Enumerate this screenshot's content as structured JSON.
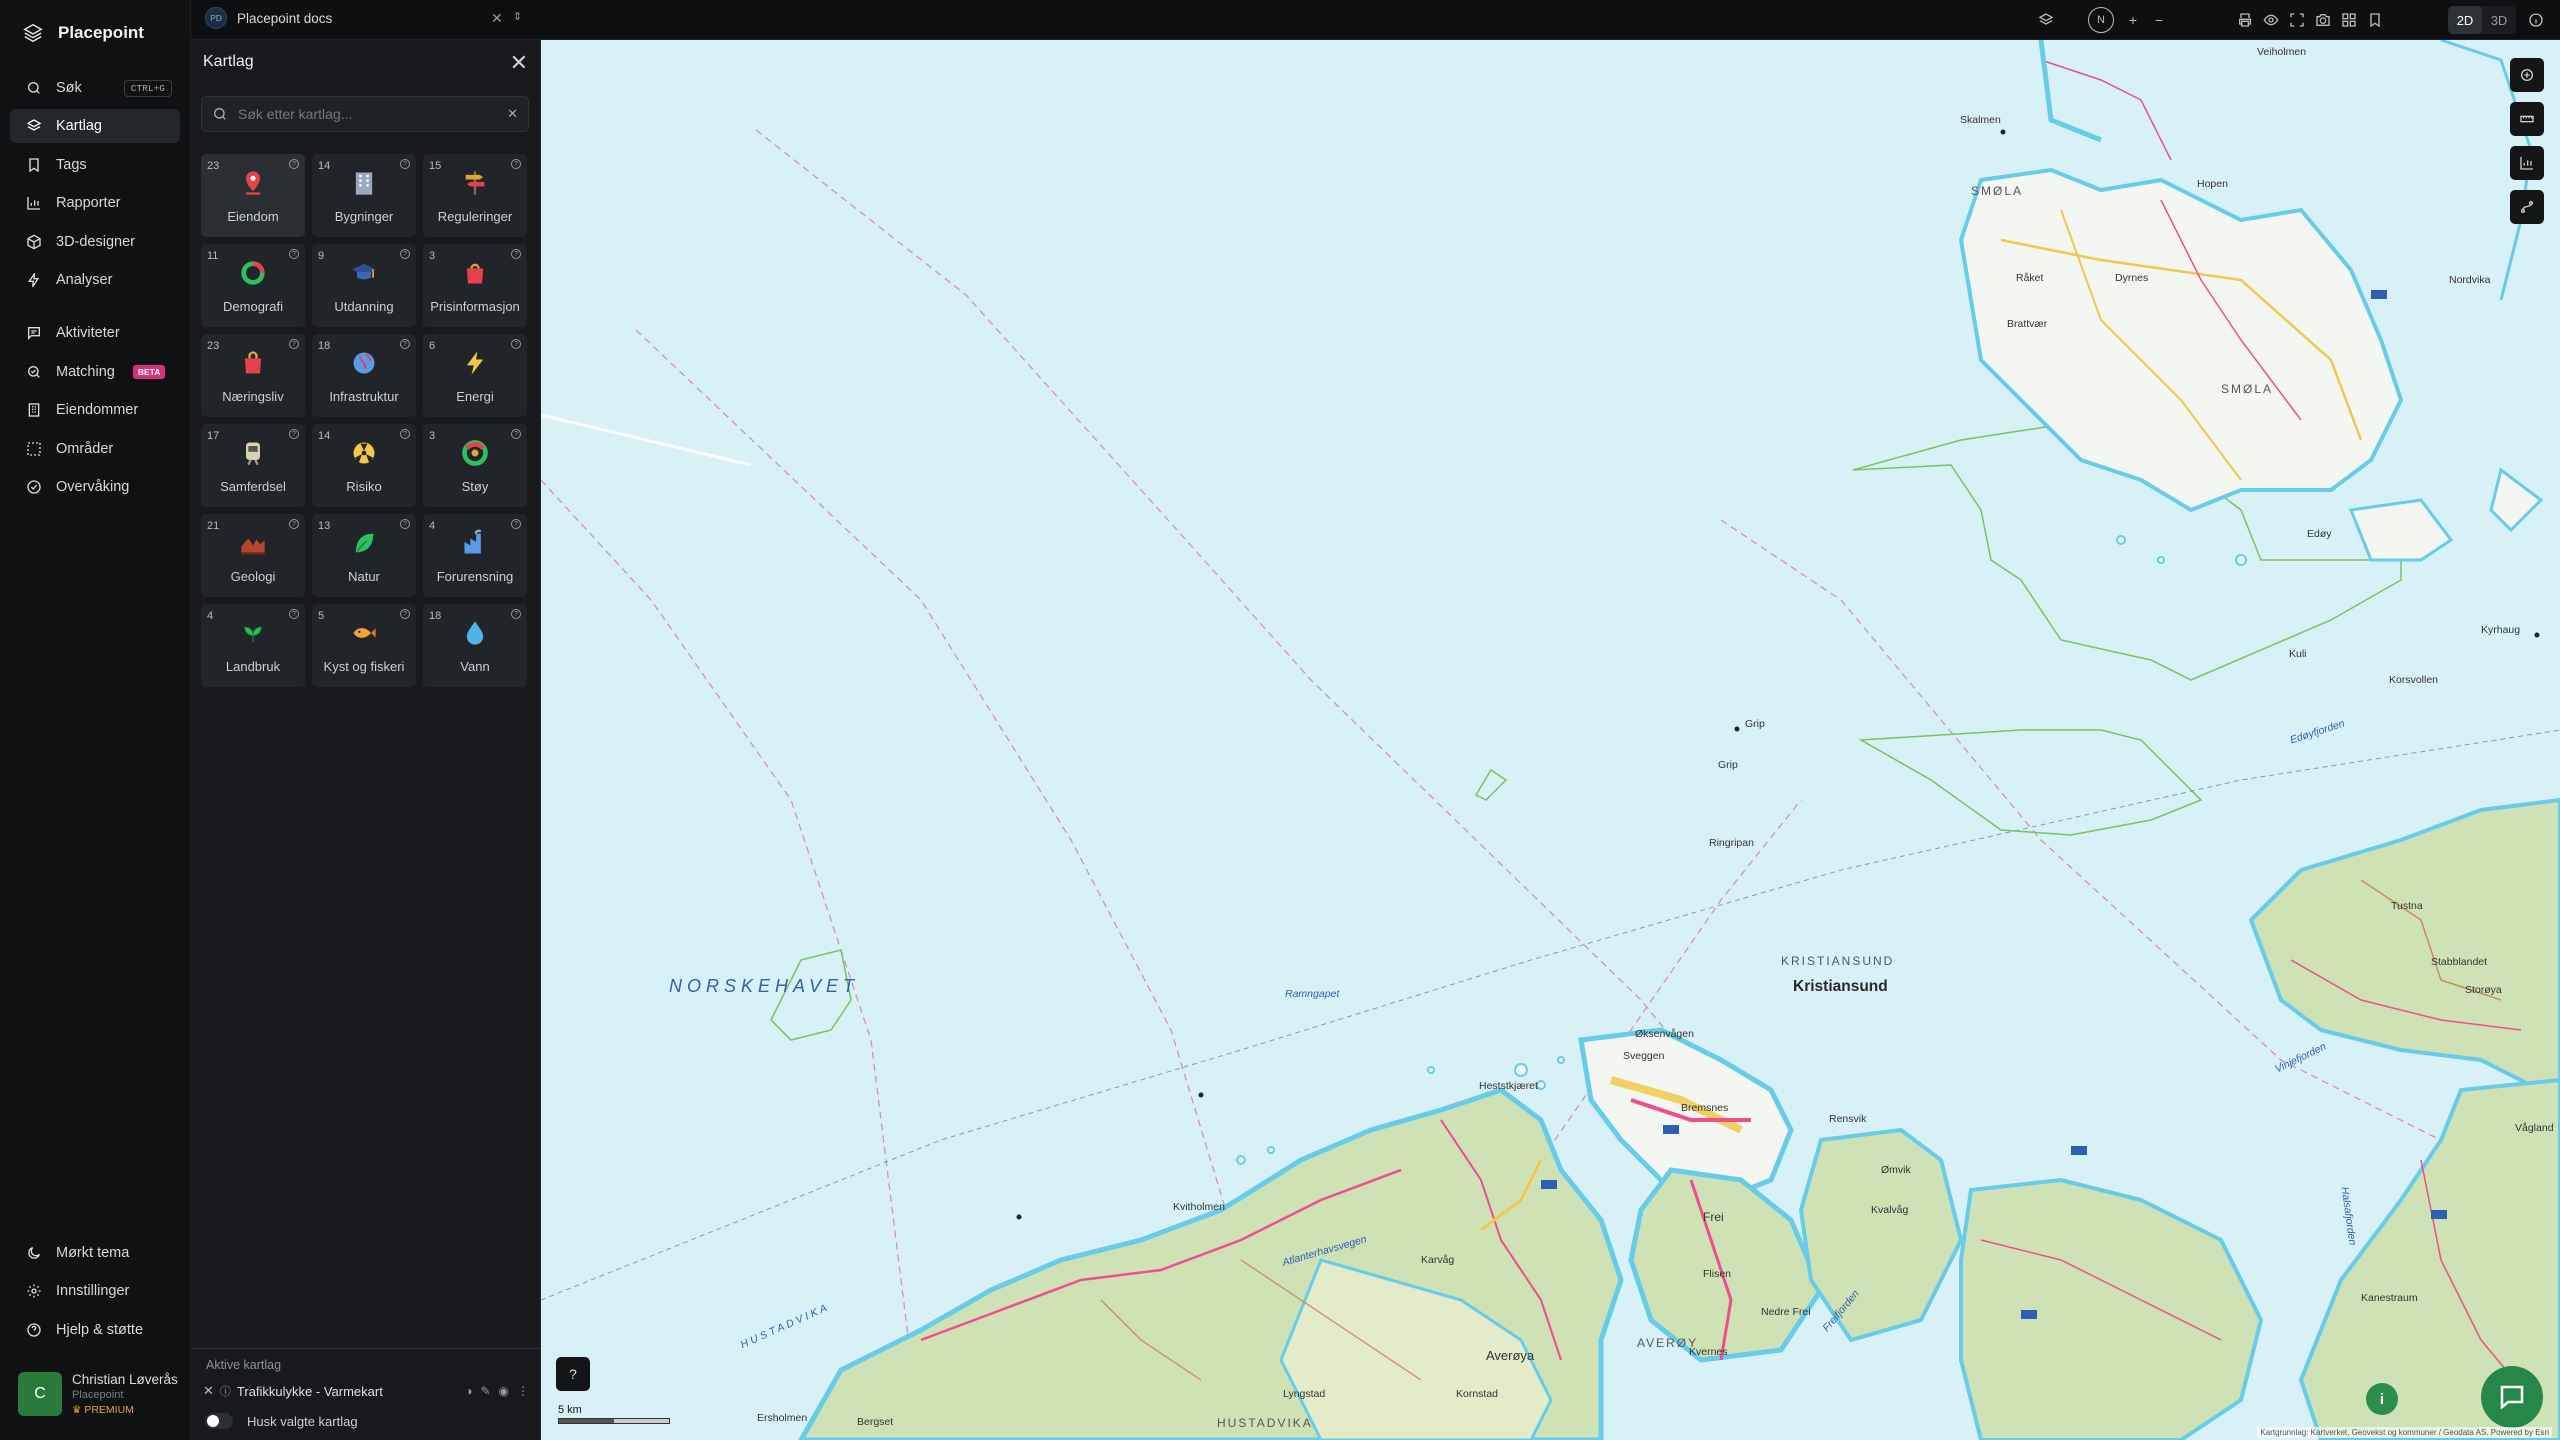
{
  "app": {
    "name": "Placepoint"
  },
  "nav": {
    "items": [
      {
        "label": "Søk",
        "icon": "search-icon",
        "shortcut": "CTRL+G"
      },
      {
        "label": "Kartlag",
        "icon": "layers-icon",
        "active": true
      },
      {
        "label": "Tags",
        "icon": "bookmark-icon"
      },
      {
        "label": "Rapporter",
        "icon": "bar-chart-icon"
      },
      {
        "label": "3D-designer",
        "icon": "cube-icon"
      },
      {
        "label": "Analyser",
        "icon": "bolt-icon"
      },
      {
        "label": "Aktiviteter",
        "icon": "chat-icon"
      },
      {
        "label": "Matching",
        "icon": "match-icon",
        "badge": "BETA"
      },
      {
        "label": "Eiendommer",
        "icon": "building-icon"
      },
      {
        "label": "Områder",
        "icon": "area-icon"
      },
      {
        "label": "Overvåking",
        "icon": "monitor-icon"
      }
    ],
    "bottom": [
      {
        "label": "Mørkt tema",
        "icon": "moon-icon"
      },
      {
        "label": "Innstillinger",
        "icon": "gear-icon"
      },
      {
        "label": "Hjelp & støtte",
        "icon": "help-icon"
      }
    ],
    "user": {
      "initial": "C",
      "name": "Christian Løverås",
      "org": "Placepoint",
      "plan": "PREMIUM"
    }
  },
  "topbar": {
    "doc_badge": "PD",
    "doc_title": "Placepoint docs",
    "compass": "N",
    "view_2d": "2D",
    "view_3d": "3D"
  },
  "panel": {
    "title": "Kartlag",
    "search_placeholder": "Søk etter kartlag...",
    "categories": [
      {
        "label": "Eiendom",
        "count": "23",
        "icon": "pin-icon",
        "selected": true
      },
      {
        "label": "Bygninger",
        "count": "14",
        "icon": "office-icon"
      },
      {
        "label": "Reguleringer",
        "count": "15",
        "icon": "signpost-icon"
      },
      {
        "label": "Demografi",
        "count": "11",
        "icon": "donut-icon"
      },
      {
        "label": "Utdanning",
        "count": "9",
        "icon": "graduation-icon"
      },
      {
        "label": "Prisinformasjon",
        "count": "3",
        "icon": "price-bag-icon"
      },
      {
        "label": "Næringsliv",
        "count": "23",
        "icon": "shopping-bag-icon"
      },
      {
        "label": "Infrastruktur",
        "count": "18",
        "icon": "globe-icon"
      },
      {
        "label": "Energi",
        "count": "6",
        "icon": "lightning-icon"
      },
      {
        "label": "Samferdsel",
        "count": "17",
        "icon": "train-icon"
      },
      {
        "label": "Risiko",
        "count": "14",
        "icon": "radiation-icon"
      },
      {
        "label": "Støy",
        "count": "3",
        "icon": "noise-gauge-icon"
      },
      {
        "label": "Geologi",
        "count": "21",
        "icon": "terrain-icon"
      },
      {
        "label": "Natur",
        "count": "13",
        "icon": "leaf-icon"
      },
      {
        "label": "Forurensning",
        "count": "4",
        "icon": "factory-icon"
      },
      {
        "label": "Landbruk",
        "count": "4",
        "icon": "sprout-icon"
      },
      {
        "label": "Kyst og fiskeri",
        "count": "5",
        "icon": "fish-icon"
      },
      {
        "label": "Vann",
        "count": "18",
        "icon": "water-drop-icon"
      }
    ],
    "active_title": "Aktive kartlag",
    "active_layers": [
      {
        "label": "Trafikkulykke - Varmekart"
      }
    ],
    "remember_label": "Husk valgte kartlag"
  },
  "map": {
    "labels": {
      "sea": "NORSKEHAVET",
      "kristiansund_caps": "KRISTIANSUND",
      "kristiansund": "Kristiansund",
      "smola_caps": "SMØLA",
      "smola": "SMØLA",
      "hustadvika_sea": "HUSTADVIKA",
      "hustadvika": "HUSTADVIKA",
      "averoy": "AVERØY",
      "averoy2": "Averøya",
      "ramngapet": "Ramngapet",
      "grip": "Grip",
      "grip2": "Grip",
      "ringripan": "Ringripan",
      "skalmen": "Skalmen",
      "kvitholmen": "Kvitholmen",
      "heststkjaeret": "Heststkjæret",
      "edoyfjorden": "Edøyfjorden",
      "frei": "Frei",
      "rensvik": "Rensvik",
      "tustna": "Tustna",
      "edoy": "Edøy",
      "kuli": "Kuli",
      "veiholmen": "Veiholmen",
      "hopen": "Hopen",
      "nordvika": "Nordvika",
      "dyrnes": "Dyrnes",
      "raket": "Råket",
      "brattvaer": "Brattvær",
      "kornstad": "Kornstad",
      "karvag": "Karvåg",
      "bremsnes": "Bremsnes",
      "atlanterhavsvegen": "Atlanterhavsvegen",
      "freifjorden": "Freifjorden",
      "vinjefjorden": "Vinjefjorden",
      "halsafjorden": "Halsafjorden",
      "kyrhaug": "Kyrhaug",
      "korsvollen": "Korsvollen",
      "kvalvag": "Kvalvåg",
      "omvik": "Ømvik",
      "sveggen": "Sveggen",
      "oksenvagen": "Øksenvågen",
      "storoya": "Storøya",
      "stabblandet": "Stabblandet",
      "vagland": "Vågland",
      "kanestraum": "Kanestraum",
      "ersholmen": "Ersholmen",
      "bergset": "Bergset",
      "lyngstad": "Lyngstad",
      "kvernes": "Kvernes",
      "flisen": "Flisen",
      "nedre_frei": "Nedre Frei"
    },
    "scale_label": "5 km",
    "attribution": "Kartgrunnlag: Kartverket, Geovekst og kommuner / Geodata AS. Powered by Esri"
  }
}
